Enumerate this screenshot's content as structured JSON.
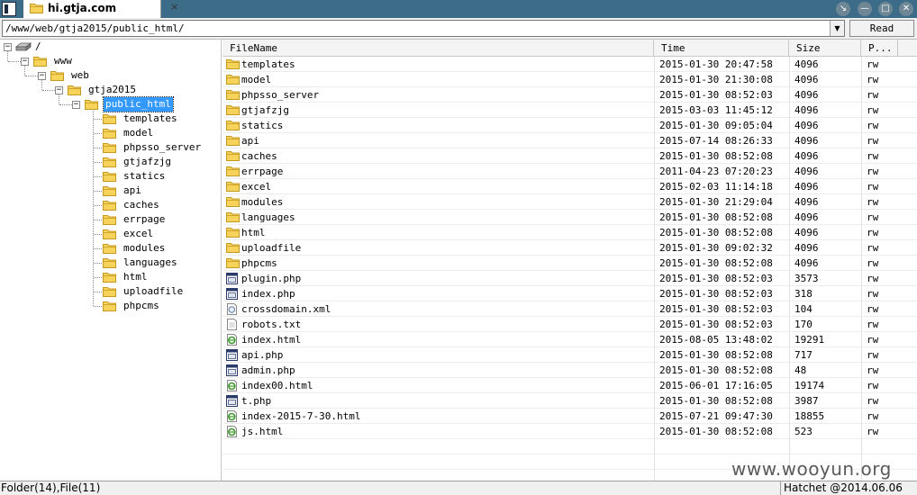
{
  "window": {
    "tab_title": "hi.gtja.com",
    "tab_close": "×",
    "controls": {
      "restore": "↘",
      "minimize": "—",
      "maximize": "□",
      "close": "✕"
    }
  },
  "address": {
    "path": "/www/web/gtja2015/public_html/",
    "dropdown_arrow": "▼",
    "read_label": "Read"
  },
  "tree": {
    "root": "/",
    "nodes": [
      {
        "label": "www"
      },
      {
        "label": "web"
      },
      {
        "label": "gtja2015"
      },
      {
        "label": "public_html"
      }
    ],
    "children": [
      "templates",
      "model",
      "phpsso_server",
      "gtjafzjg",
      "statics",
      "api",
      "caches",
      "errpage",
      "excel",
      "modules",
      "languages",
      "html",
      "uploadfile",
      "phpcms"
    ],
    "toggle_symbol": "−"
  },
  "list": {
    "columns": {
      "name": "FileName",
      "time": "Time",
      "size": "Size",
      "perm": "P..."
    },
    "rows": [
      {
        "name": "templates",
        "time": "2015-01-30 20:47:58",
        "size": "4096",
        "perm": "rw",
        "icon": "folder"
      },
      {
        "name": "model",
        "time": "2015-01-30 21:30:08",
        "size": "4096",
        "perm": "rw",
        "icon": "folder"
      },
      {
        "name": "phpsso_server",
        "time": "2015-01-30 08:52:03",
        "size": "4096",
        "perm": "rw",
        "icon": "folder"
      },
      {
        "name": "gtjafzjg",
        "time": "2015-03-03 11:45:12",
        "size": "4096",
        "perm": "rw",
        "icon": "folder"
      },
      {
        "name": "statics",
        "time": "2015-01-30 09:05:04",
        "size": "4096",
        "perm": "rw",
        "icon": "folder"
      },
      {
        "name": "api",
        "time": "2015-07-14 08:26:33",
        "size": "4096",
        "perm": "rw",
        "icon": "folder"
      },
      {
        "name": "caches",
        "time": "2015-01-30 08:52:08",
        "size": "4096",
        "perm": "rw",
        "icon": "folder"
      },
      {
        "name": "errpage",
        "time": "2011-04-23 07:20:23",
        "size": "4096",
        "perm": "rw",
        "icon": "folder"
      },
      {
        "name": "excel",
        "time": "2015-02-03 11:14:18",
        "size": "4096",
        "perm": "rw",
        "icon": "folder"
      },
      {
        "name": "modules",
        "time": "2015-01-30 21:29:04",
        "size": "4096",
        "perm": "rw",
        "icon": "folder"
      },
      {
        "name": "languages",
        "time": "2015-01-30 08:52:08",
        "size": "4096",
        "perm": "rw",
        "icon": "folder"
      },
      {
        "name": "html",
        "time": "2015-01-30 08:52:08",
        "size": "4096",
        "perm": "rw",
        "icon": "folder"
      },
      {
        "name": "uploadfile",
        "time": "2015-01-30 09:02:32",
        "size": "4096",
        "perm": "rw",
        "icon": "folder"
      },
      {
        "name": "phpcms",
        "time": "2015-01-30 08:52:08",
        "size": "4096",
        "perm": "rw",
        "icon": "folder"
      },
      {
        "name": "plugin.php",
        "time": "2015-01-30 08:52:03",
        "size": "3573",
        "perm": "rw",
        "icon": "php"
      },
      {
        "name": "index.php",
        "time": "2015-01-30 08:52:03",
        "size": "318",
        "perm": "rw",
        "icon": "php"
      },
      {
        "name": "crossdomain.xml",
        "time": "2015-01-30 08:52:03",
        "size": "104",
        "perm": "rw",
        "icon": "xml"
      },
      {
        "name": "robots.txt",
        "time": "2015-01-30 08:52:03",
        "size": "170",
        "perm": "rw",
        "icon": "txt"
      },
      {
        "name": "index.html",
        "time": "2015-08-05 13:48:02",
        "size": "19291",
        "perm": "rw",
        "icon": "html"
      },
      {
        "name": "api.php",
        "time": "2015-01-30 08:52:08",
        "size": "717",
        "perm": "rw",
        "icon": "php"
      },
      {
        "name": "admin.php",
        "time": "2015-01-30 08:52:08",
        "size": "48",
        "perm": "rw",
        "icon": "php"
      },
      {
        "name": "index00.html",
        "time": "2015-06-01 17:16:05",
        "size": "19174",
        "perm": "rw",
        "icon": "html"
      },
      {
        "name": "t.php",
        "time": "2015-01-30 08:52:08",
        "size": "3987",
        "perm": "rw",
        "icon": "php"
      },
      {
        "name": "index-2015-7-30.html",
        "time": "2015-07-21 09:47:30",
        "size": "18855",
        "perm": "rw",
        "icon": "html"
      },
      {
        "name": "js.html",
        "time": "2015-01-30 08:52:08",
        "size": "523",
        "perm": "rw",
        "icon": "html"
      }
    ]
  },
  "status": {
    "left": "Folder(14),File(11)",
    "right": "Hatchet @2014.06.06"
  },
  "watermark": "www.wooyun.org",
  "colors": {
    "titlebar": "#3c6c88",
    "selection": "#3399ff",
    "folder_fill": "#f7d35c",
    "folder_stroke": "#c49a1e",
    "html_icon": "#3d9a2f"
  }
}
